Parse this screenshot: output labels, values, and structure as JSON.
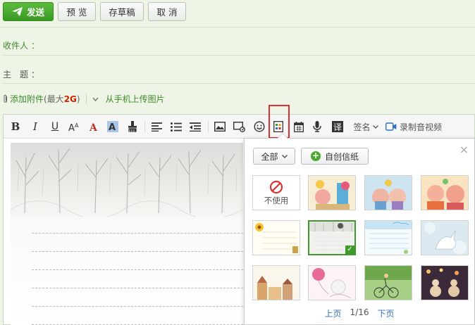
{
  "toolbar": {
    "send_label": "发送",
    "preview_label": "预 览",
    "draft_label": "存草稿",
    "cancel_label": "取 消"
  },
  "compose": {
    "recipient_label": "收件人 ：",
    "subject_label": "主　题 ：",
    "attach_label": "添加附件",
    "attach_limit_prefix": "(最大",
    "attach_limit_value": "2G",
    "attach_limit_suffix": ")",
    "upload_phone_label": "从手机上传图片"
  },
  "editor_toolbar": {
    "signature_label": "签名",
    "record_label": "录制音视频"
  },
  "stationery_popup": {
    "category_select": "全部",
    "custom_button": "自创信纸",
    "no_use_label": "不使用",
    "prev_page": "上页",
    "page_indicator": "1/16",
    "next_page": "下页",
    "close_icon": "close-icon"
  },
  "colors": {
    "accent": "#3e8a2a",
    "send_button": "#4aa82e",
    "highlight_box": "#e03030",
    "link": "#2f6fbf"
  }
}
